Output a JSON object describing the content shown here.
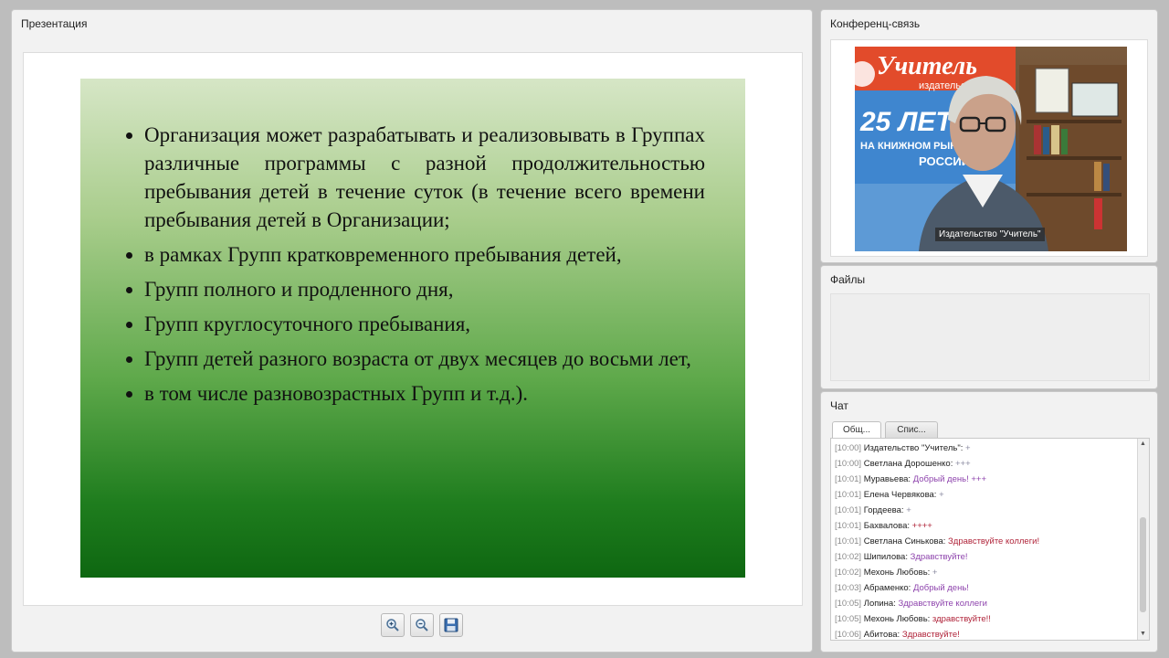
{
  "presentation": {
    "title": "Презентация",
    "slide": {
      "bullets": [
        "Организация может разрабатывать и реализовывать в Группах различные программы с разной продолжительностью пребывания детей в течение суток (в течение всего времени пребывания детей в Организации;",
        "в рамках Групп кратковременного пребывания детей,",
        "Групп полного и продленного дня,",
        "Групп круглосуточного пребывания,",
        "Групп детей разного возраста от двух месяцев до восьми лет,",
        "в том числе разновозрастных Групп и т.д.)."
      ]
    },
    "toolbar": {
      "zoom_in_icon": "zoom-in-icon",
      "zoom_out_icon": "zoom-out-icon",
      "save_icon": "floppy-disk-icon"
    }
  },
  "conference": {
    "title": "Конференц-связь",
    "video": {
      "banner_line1": "Учитель",
      "banner_line2": "издательство",
      "banner_line3": "25 ЛЕТ",
      "banner_line4": "НА КНИЖНОМ РЫНКЕ",
      "banner_line5": "РОССИИ",
      "participant_label": "Издательство \"Учитель\""
    }
  },
  "files": {
    "title": "Файлы"
  },
  "chat": {
    "title": "Чат",
    "tabs": [
      "Общ...",
      "Спис..."
    ],
    "messages": [
      {
        "time": "[10:00]",
        "author": "Издательство \"Учитель\":",
        "text": "+",
        "style": "plus"
      },
      {
        "time": "[10:00]",
        "author": "Светлана Дорошенко:",
        "text": "+++",
        "style": "plus"
      },
      {
        "time": "[10:01]",
        "author": "Муравьева:",
        "text": "Добрый день! +++",
        "style": "purple"
      },
      {
        "time": "[10:01]",
        "author": "Елена Червякова:",
        "text": "+",
        "style": "plus"
      },
      {
        "time": "[10:01]",
        "author": "Гордеева:",
        "text": "+",
        "style": "plus"
      },
      {
        "time": "[10:01]",
        "author": "Бахвалова:",
        "text": "++++",
        "style": "red"
      },
      {
        "time": "[10:01]",
        "author": "Светлана Синькова:",
        "text": "Здравствуйте коллеги!",
        "style": "red"
      },
      {
        "time": "[10:02]",
        "author": "Шипилова:",
        "text": "Здравствуйте!",
        "style": "purple"
      },
      {
        "time": "[10:02]",
        "author": "Мехонь Любовь:",
        "text": "+",
        "style": "plus"
      },
      {
        "time": "[10:03]",
        "author": "Абраменко:",
        "text": "Добрый день!",
        "style": "purple"
      },
      {
        "time": "[10:05]",
        "author": "Лопина:",
        "text": "Здравствуйте коллеги",
        "style": "purple"
      },
      {
        "time": "[10:05]",
        "author": "Мехонь Любовь:",
        "text": "здравствуйте!!",
        "style": "red"
      },
      {
        "time": "[10:06]",
        "author": "Абитова:",
        "text": "Здравствуйте!",
        "style": "red"
      }
    ]
  }
}
